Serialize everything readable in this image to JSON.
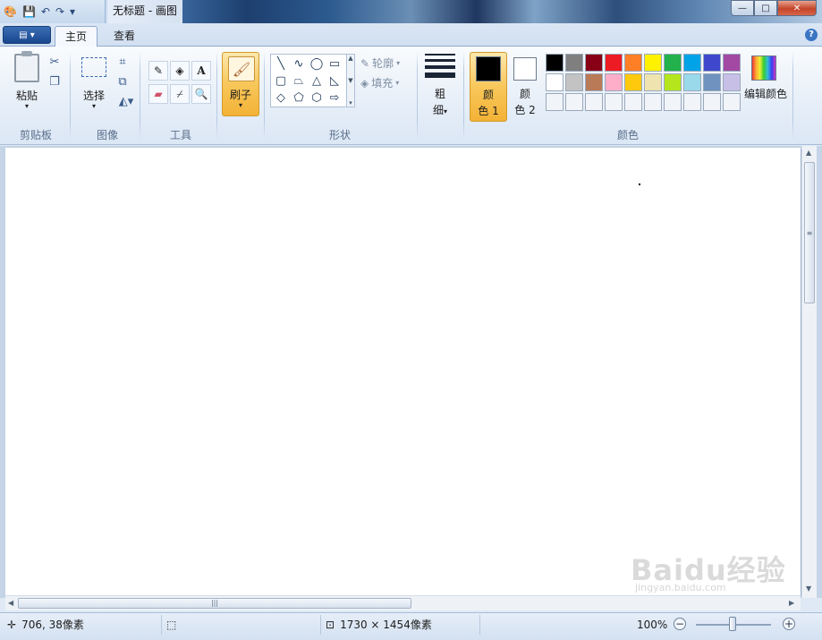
{
  "window": {
    "title": "无标题 - 画图",
    "minimize_glyph": "—",
    "maximize_glyph": "□",
    "close_glyph": "✕"
  },
  "menu": {
    "app_menu_glyph": "▤ ▾",
    "tabs": [
      {
        "label": "主页",
        "active": true
      },
      {
        "label": "查看",
        "active": false
      }
    ],
    "help_glyph": "?"
  },
  "ribbon": {
    "clipboard": {
      "paste_label": "粘贴",
      "group_label": "剪贴板"
    },
    "image": {
      "select_label": "选择",
      "group_label": "图像"
    },
    "tools": {
      "group_label": "工具",
      "text_glyph": "A"
    },
    "brushes": {
      "label": "刷子"
    },
    "shapes": {
      "outline_label": "轮廓",
      "fill_label": "填充",
      "group_label": "形状"
    },
    "size": {
      "label_line1": "粗",
      "label_line2": "细"
    },
    "colors": {
      "color1_line1": "颜",
      "color1_line2": "色 1",
      "color2_line1": "颜",
      "color2_line2": "色 2",
      "edit_label": "编辑颜色",
      "group_label": "颜色",
      "color1_value": "#000000",
      "color2_value": "#ffffff",
      "palette_row1": [
        "#000000",
        "#7f7f7f",
        "#880015",
        "#ed1c24",
        "#ff7f27",
        "#fff200",
        "#22b14c",
        "#00a2e8",
        "#3f48cc",
        "#a349a4"
      ],
      "palette_row2": [
        "#ffffff",
        "#c3c3c3",
        "#b97a57",
        "#ffaec9",
        "#ffc90e",
        "#efe4b0",
        "#b5e61d",
        "#99d9ea",
        "#7092be",
        "#c8bfe7"
      ],
      "palette_row3": [
        "#f1f4f8",
        "#f1f4f8",
        "#f1f4f8",
        "#f1f4f8",
        "#f1f4f8",
        "#f1f4f8",
        "#f1f4f8",
        "#f1f4f8",
        "#f1f4f8",
        "#f1f4f8"
      ]
    }
  },
  "status": {
    "cursor_position": "706, 38像素",
    "canvas_size": "1730 × 1454像素",
    "zoom": "100%"
  },
  "watermark": {
    "text": "Baidu经验",
    "sub": "jingyan.baidu.com"
  }
}
